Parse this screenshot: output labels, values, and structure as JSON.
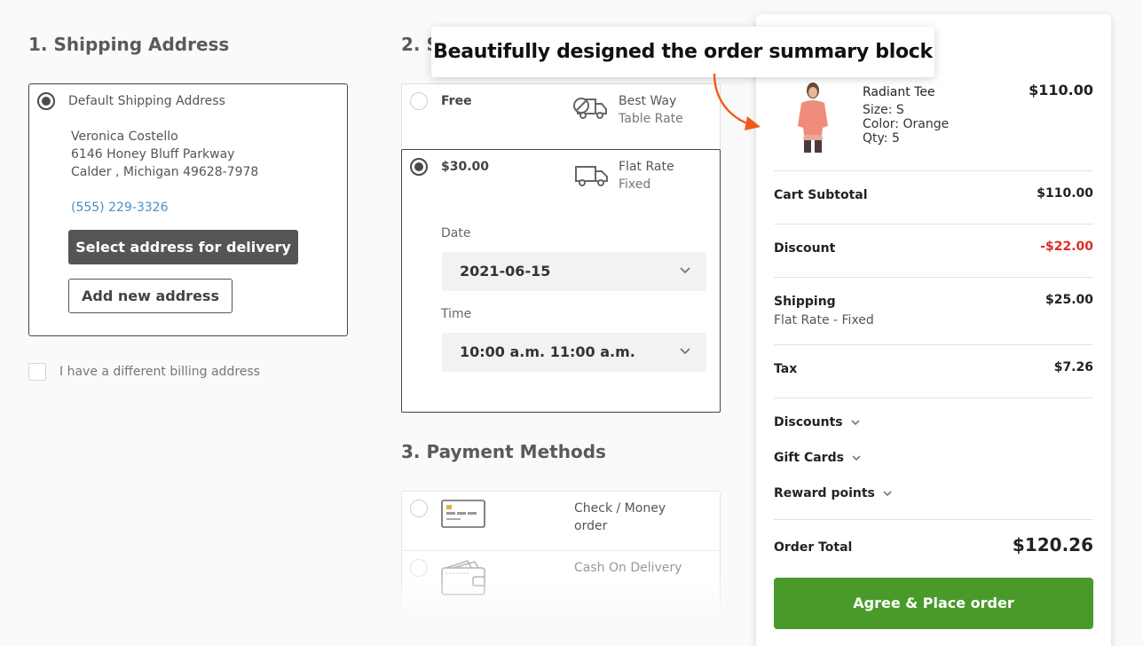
{
  "shipping_address": {
    "title": "1. Shipping Address",
    "default_label": "Default Shipping Address",
    "name": "Veronica Costello",
    "street": "6146 Honey Bluff Parkway",
    "city_line": "Calder , Michigan 49628-7978",
    "phone": "(555) 229-3326",
    "select_button": "Select address for delivery",
    "add_button": "Add new address",
    "billing_checkbox_label": "I have a different billing address"
  },
  "shipping_methods": {
    "title": "2. S",
    "options": [
      {
        "price": "Free",
        "carrier": "Best Way",
        "method": "Table Rate",
        "selected": false,
        "icon": "truck-free-icon"
      },
      {
        "price": "$30.00",
        "carrier": "Flat Rate",
        "method": "Fixed",
        "selected": true,
        "icon": "truck-icon"
      }
    ],
    "date_label": "Date",
    "date_value": "2021-06-15",
    "time_label": "Time",
    "time_value": "10:00 a.m. 11:00 a.m."
  },
  "payment": {
    "title": "3. Payment Methods",
    "options": [
      {
        "label_line1": "Check / Money",
        "label_line2": "order",
        "icon": "credit-card-icon"
      },
      {
        "label": "Cash On Delivery",
        "icon": "wallet-icon"
      }
    ]
  },
  "callout": {
    "text": "Beautifully designed the order summary block"
  },
  "summary": {
    "item": {
      "name": "Radiant Tee",
      "price": "$110.00",
      "size": "Size: S",
      "color": "Color: Orange",
      "qty": "Qty: 5"
    },
    "subtotal_label": "Cart Subtotal",
    "subtotal_value": "$110.00",
    "discount_label": "Discount",
    "discount_value": "-$22.00",
    "shipping_label": "Shipping",
    "shipping_value": "$25.00",
    "shipping_method": "Flat Rate - Fixed",
    "tax_label": "Tax",
    "tax_value": "$7.26",
    "collapsibles": [
      "Discounts",
      "Gift Cards",
      "Reward points"
    ],
    "total_label": "Order Total",
    "total_value": "$120.26",
    "place_order": "Agree & Place order"
  },
  "colors": {
    "accent_green": "#4a9a2b",
    "discount_red": "#e02b27",
    "link_blue": "#4a8fc4",
    "arrow_orange": "#f05a1a"
  }
}
